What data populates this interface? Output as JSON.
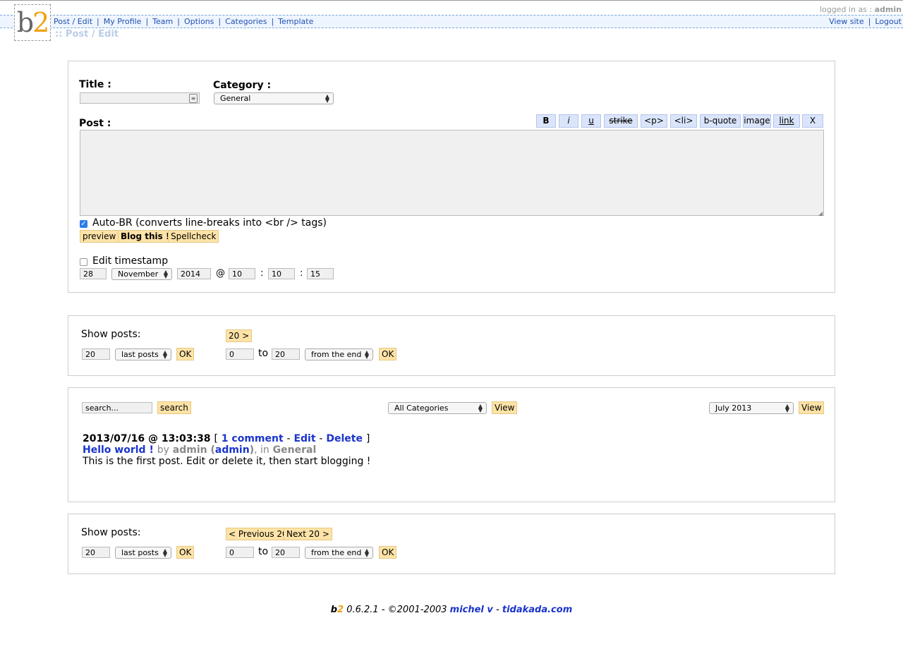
{
  "header": {
    "logged_label": "logged in as :",
    "logged_user": "admin",
    "logo_b": "b",
    "logo_2": "2",
    "nav": [
      "Post / Edit",
      "My Profile",
      "Team",
      "Options",
      "Categories",
      "Template"
    ],
    "view_site": "View site",
    "logout": "Logout",
    "breadcrumb": ":: Post / Edit"
  },
  "editor": {
    "title_label": "Title :",
    "title_value": "",
    "category_label": "Category :",
    "category_value": "General",
    "post_label": "Post :",
    "quicktags": [
      "B",
      "i",
      "u",
      "strike",
      "<p>",
      "<li>",
      "b-quote",
      "image",
      "link",
      "X"
    ],
    "post_value": "",
    "autobr_checked": true,
    "autobr_label": "Auto-BR (converts line-breaks into <br /> tags)",
    "preview_btn": "preview",
    "blog_btn": "Blog this !",
    "spell_btn": "Spellcheck",
    "timestamp_checked": false,
    "timestamp_label": "Edit timestamp",
    "day": "28",
    "month": "November",
    "year": "2014",
    "at": "@",
    "hour": "10",
    "minute": "10",
    "second": "15",
    "colon": ":"
  },
  "show_top": {
    "label": "Show posts:",
    "count": "20",
    "mode": "last posts",
    "ok": "OK",
    "next_btn": "20 >",
    "from": "0",
    "to_label": "to",
    "to": "20",
    "range_mode": "from the end"
  },
  "filter": {
    "search_value": "search...",
    "search_btn": "search",
    "categories": "All Categories",
    "view_btn": "View",
    "month": "July 2013"
  },
  "post": {
    "datetime": "2013/07/16 @ 13:03:38",
    "bracket_open": "[",
    "comments": "1 comment",
    "dash": "-",
    "edit": "Edit",
    "delete": "Delete",
    "bracket_close": "]",
    "title": "Hello world !",
    "by": "by",
    "author": "admin",
    "author_login": "admin",
    "in": ", in",
    "category": "General",
    "body": "This is the first post. Edit or delete it, then start blogging !"
  },
  "show_bottom": {
    "label": "Show posts:",
    "prev_btn": "< Previous 20",
    "next_btn": "Next 20 >",
    "count": "20",
    "mode": "last posts",
    "ok": "OK",
    "from": "0",
    "to_label": "to",
    "to": "20",
    "range_mode": "from the end"
  },
  "footer": {
    "b": "b",
    "two": "2",
    "version": " 0.6.2.1 - ©2001-2003 ",
    "author": "michel v",
    "sep": " - ",
    "site": "tidakada.com"
  },
  "colors": {
    "accent_link": "#1a34cc",
    "button_bg": "#fde3a7",
    "quicktag_bg": "#dae5fb",
    "logo_orange": "#f0a010"
  }
}
